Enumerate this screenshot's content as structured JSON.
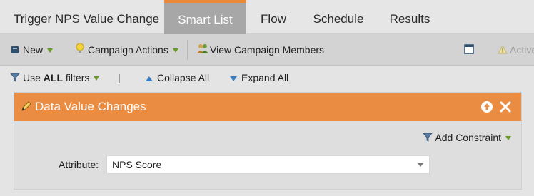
{
  "tabs": [
    {
      "label": "Trigger NPS Value Change"
    },
    {
      "label": "Smart List"
    },
    {
      "label": "Flow"
    },
    {
      "label": "Schedule"
    },
    {
      "label": "Results"
    }
  ],
  "toolbar": {
    "new_label": "New",
    "campaign_actions_label": "Campaign Actions",
    "view_members_label": "View Campaign Members",
    "active_label": "Active"
  },
  "filterbar": {
    "use_all_prefix": "Use ",
    "use_all_bold": "ALL",
    "use_all_suffix": " filters",
    "divider": "|",
    "collapse_label": "Collapse All",
    "expand_label": "Expand All"
  },
  "panel": {
    "title": "Data Value Changes",
    "add_constraint_label": "Add Constraint",
    "attribute_label": "Attribute:",
    "attribute_value": "NPS Score"
  },
  "colors": {
    "accent_orange": "#ea8d43",
    "active_tab": "#a7a7a7",
    "link_blue": "#3a7bc0"
  }
}
